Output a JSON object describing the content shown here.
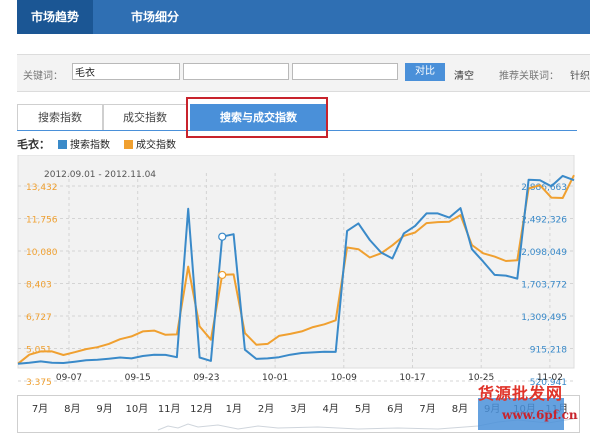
{
  "top_nav": {
    "tabs": [
      {
        "label": "市场趋势",
        "active": true
      },
      {
        "label": "市场细分",
        "active": false
      }
    ]
  },
  "search": {
    "keyword_label": "关键词：",
    "keyword_value": "毛衣",
    "compare_label": "对比",
    "clear_label": "清空",
    "recommend_label": "推荐关联词：",
    "recommend_first": "针织"
  },
  "sub_tabs": [
    {
      "label": "搜索指数",
      "active": false
    },
    {
      "label": "成交指数",
      "active": false
    },
    {
      "label": "搜索与成交指数",
      "active": true
    }
  ],
  "legend": {
    "keyword": "毛衣：",
    "series": [
      {
        "name": "搜索指数",
        "color": "#3a8ac9"
      },
      {
        "name": "成交指数",
        "color": "#f0a030"
      }
    ]
  },
  "chart_data": {
    "type": "line",
    "date_range": "2012.09.01 - 2012.11.04",
    "x_ticks": [
      "09-07",
      "09-15",
      "09-23",
      "10-01",
      "10-09",
      "10-17",
      "10-25",
      "11-02"
    ],
    "y_left_ticks": [
      "13,432",
      "11,756",
      "10,080",
      "8,403",
      "6,727",
      "5,051",
      "3,375"
    ],
    "y_right_ticks": [
      "2,886,663",
      "2,492,326",
      "2,098,049",
      "1,703,772",
      "1,309,495",
      "915,218",
      "520,941"
    ],
    "ylim_left": [
      1700,
      13432
    ],
    "grid": true,
    "series": [
      {
        "name": "搜索指数",
        "color": "#3a8ac9",
        "values": [
          1960,
          2020,
          2100,
          2020,
          2000,
          2080,
          2170,
          2200,
          2260,
          2330,
          2280,
          2420,
          2500,
          2490,
          2350,
          11280,
          2330,
          2130,
          9600,
          9750,
          2800,
          2250,
          2280,
          2350,
          2500,
          2600,
          2640,
          2680,
          2670,
          9950,
          10400,
          9400,
          8650,
          8290,
          9800,
          10250,
          11000,
          11000,
          10750,
          11320,
          8850,
          8100,
          7300,
          7260,
          7080,
          13030,
          13000,
          12640,
          13260,
          13000
        ]
      },
      {
        "name": "成交指数",
        "color": "#f0a030",
        "values": [
          1960,
          2500,
          2700,
          2700,
          2480,
          2650,
          2840,
          2950,
          3150,
          3430,
          3600,
          3900,
          3950,
          3700,
          3720,
          7800,
          4200,
          3400,
          7300,
          7330,
          3800,
          3100,
          3150,
          3630,
          3750,
          3900,
          4160,
          4330,
          4570,
          8950,
          8850,
          8350,
          8600,
          9080,
          9650,
          9850,
          10420,
          10480,
          10500,
          10900,
          9100,
          8600,
          8400,
          8140,
          8180,
          12500,
          12700,
          11950,
          11930,
          13300
        ]
      }
    ],
    "annotation_markers": [
      {
        "x_index": 18,
        "series": "搜索指数"
      },
      {
        "x_index": 18,
        "series": "成交指数"
      }
    ]
  },
  "timeline": {
    "months": [
      "7月",
      "8月",
      "9月",
      "10月",
      "11月",
      "12月",
      "1月",
      "2月",
      "3月",
      "4月",
      "5月",
      "6月",
      "7月",
      "8月",
      "9月",
      "10月",
      "11月"
    ]
  },
  "watermark": {
    "line1": "货源批发网",
    "line2": "www.6pf.cn"
  }
}
